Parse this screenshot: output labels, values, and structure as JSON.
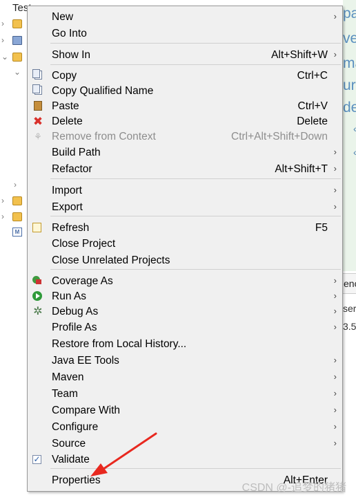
{
  "background": {
    "tree_top_text": "Test",
    "editor_fragments": [
      "pa",
      "ve",
      "ma",
      "ur",
      "de"
    ],
    "editor_arrows": [
      "‹",
      "‹"
    ],
    "console_tab_fragment": "enc",
    "line_fragments": [
      "ser",
      "3.5"
    ]
  },
  "menu": {
    "items": [
      {
        "label": "New",
        "shortcut": "",
        "submenu": true,
        "icon": ""
      },
      {
        "label": "Go Into",
        "shortcut": "",
        "submenu": false,
        "icon": ""
      },
      {
        "label": "Show In",
        "shortcut": "Alt+Shift+W",
        "submenu": true,
        "icon": ""
      },
      {
        "label": "Copy",
        "shortcut": "Ctrl+C",
        "submenu": false,
        "icon": "copy-icon"
      },
      {
        "label": "Copy Qualified Name",
        "shortcut": "",
        "submenu": false,
        "icon": "copy-qualified-name-icon"
      },
      {
        "label": "Paste",
        "shortcut": "Ctrl+V",
        "submenu": false,
        "icon": "paste-icon"
      },
      {
        "label": "Delete",
        "shortcut": "Delete",
        "submenu": false,
        "icon": "delete-icon"
      },
      {
        "label": "Remove from Context",
        "shortcut": "Ctrl+Alt+Shift+Down",
        "submenu": false,
        "icon": "remove-context-icon",
        "disabled": true
      },
      {
        "label": "Build Path",
        "shortcut": "",
        "submenu": true,
        "icon": ""
      },
      {
        "label": "Refactor",
        "shortcut": "Alt+Shift+T",
        "submenu": true,
        "icon": ""
      },
      {
        "label": "Import",
        "shortcut": "",
        "submenu": true,
        "icon": ""
      },
      {
        "label": "Export",
        "shortcut": "",
        "submenu": true,
        "icon": ""
      },
      {
        "label": "Refresh",
        "shortcut": "F5",
        "submenu": false,
        "icon": "refresh-icon"
      },
      {
        "label": "Close Project",
        "shortcut": "",
        "submenu": false,
        "icon": ""
      },
      {
        "label": "Close Unrelated Projects",
        "shortcut": "",
        "submenu": false,
        "icon": ""
      },
      {
        "label": "Coverage As",
        "shortcut": "",
        "submenu": true,
        "icon": "coverage-icon"
      },
      {
        "label": "Run As",
        "shortcut": "",
        "submenu": true,
        "icon": "run-icon"
      },
      {
        "label": "Debug As",
        "shortcut": "",
        "submenu": true,
        "icon": "debug-icon"
      },
      {
        "label": "Profile As",
        "shortcut": "",
        "submenu": true,
        "icon": ""
      },
      {
        "label": "Restore from Local History...",
        "shortcut": "",
        "submenu": false,
        "icon": ""
      },
      {
        "label": "Java EE Tools",
        "shortcut": "",
        "submenu": true,
        "icon": ""
      },
      {
        "label": "Maven",
        "shortcut": "",
        "submenu": true,
        "icon": ""
      },
      {
        "label": "Team",
        "shortcut": "",
        "submenu": true,
        "icon": ""
      },
      {
        "label": "Compare With",
        "shortcut": "",
        "submenu": true,
        "icon": ""
      },
      {
        "label": "Configure",
        "shortcut": "",
        "submenu": true,
        "icon": ""
      },
      {
        "label": "Source",
        "shortcut": "",
        "submenu": true,
        "icon": ""
      },
      {
        "label": "Validate",
        "shortcut": "",
        "submenu": false,
        "icon": "validate-check-icon"
      },
      {
        "label": "Properties",
        "shortcut": "Alt+Enter",
        "submenu": false,
        "icon": ""
      }
    ],
    "submenu_glyph": "›"
  },
  "annotation": {
    "arrow_color": "#e8281f",
    "watermark": "CSDN @-追梦的猪猪"
  },
  "colors": {
    "menu_bg": "#f0f0f0",
    "menu_border": "#979797",
    "disabled_text": "#8e8e8e",
    "editor_bg": "#eaf4ea"
  }
}
